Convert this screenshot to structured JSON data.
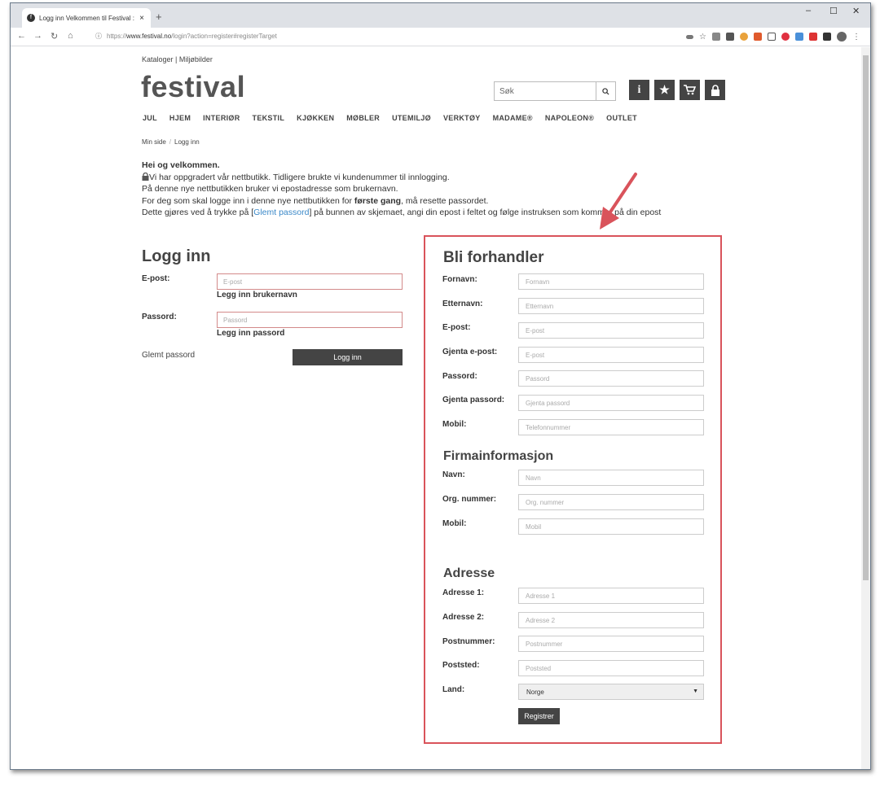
{
  "browser": {
    "tab_title": "Logg inn Velkommen til Festival :",
    "tab_close": "×",
    "new_tab": "+",
    "url_secure_icon": "ⓘ",
    "url_scheme": "https://",
    "url_host": "www.festival.no",
    "url_path": "/login?action=register#registerTarget",
    "minimize": "–",
    "maximize": "☐",
    "close": "✕"
  },
  "site": {
    "topnav": "Kataloger | Miljøbilder",
    "logo": "festival",
    "search_placeholder": "Søk",
    "search_icon": "🔍",
    "icons": {
      "info": "i",
      "favorites": "★",
      "cart": "🛒",
      "lock": "🔒"
    },
    "mainnav": [
      "JUL",
      "HJEM",
      "INTERIØR",
      "TEKSTIL",
      "KJØKKEN",
      "MØBLER",
      "UTEMILJØ",
      "VERKTØY",
      "MADAME®",
      "NAPOLEON®",
      "OUTLET"
    ],
    "breadcrumb": [
      "Min side",
      "Logg inn"
    ]
  },
  "welcome": {
    "heading": "Hei og velkommen.",
    "line1": "Vi har oppgradert vår nettbutikk. Tidligere brukte vi kundenummer til innlogging.",
    "line2": "På denne nye nettbutikken bruker vi epostadresse som brukernavn.",
    "line3_pre": "For deg som skal logge inn i denne nye nettbutikken for ",
    "line3_bold": "første gang",
    "line3_post": ", må resette passordet.",
    "line4_pre": "Dette gjøres ved å trykke på [",
    "line4_link": "Glemt passord",
    "line4_post": "] på bunnen av skjemaet, angi din epost i feltet og følge instruksen som kommer på din epost"
  },
  "login": {
    "title": "Logg inn",
    "email_label": "E-post:",
    "email_placeholder": "E-post",
    "email_hint": "Legg inn brukernavn",
    "password_label": "Passord:",
    "password_placeholder": "Passord",
    "password_hint": "Legg inn passord",
    "forgot": "Glemt passord",
    "submit": "Logg inn"
  },
  "register": {
    "title": "Bli forhandler",
    "fields": [
      {
        "label": "Fornavn:",
        "placeholder": "Fornavn"
      },
      {
        "label": "Etternavn:",
        "placeholder": "Etternavn"
      },
      {
        "label": "E-post:",
        "placeholder": "E-post"
      },
      {
        "label": "Gjenta e-post:",
        "placeholder": "E-post"
      },
      {
        "label": "Passord:",
        "placeholder": "Passord"
      },
      {
        "label": "Gjenta passord:",
        "placeholder": "Gjenta passord"
      },
      {
        "label": "Mobil:",
        "placeholder": "Telefonnummer"
      }
    ],
    "company_title": "Firmainformasjon",
    "company_fields": [
      {
        "label": "Navn:",
        "placeholder": "Navn"
      },
      {
        "label": "Org. nummer:",
        "placeholder": "Org. nummer"
      },
      {
        "label": "Mobil:",
        "placeholder": "Mobil"
      }
    ],
    "address_title": "Adresse",
    "address_fields": [
      {
        "label": "Adresse 1:",
        "placeholder": "Adresse 1"
      },
      {
        "label": "Adresse 2:",
        "placeholder": "Adresse 2"
      },
      {
        "label": "Postnummer:",
        "placeholder": "Postnummer"
      },
      {
        "label": "Poststed:",
        "placeholder": "Poststed"
      }
    ],
    "country_label": "Land:",
    "country_value": "Norge",
    "submit": "Registrer"
  },
  "colors": {
    "highlight": "#d9535b",
    "dark_button": "#444444",
    "link": "#3a88c8"
  }
}
